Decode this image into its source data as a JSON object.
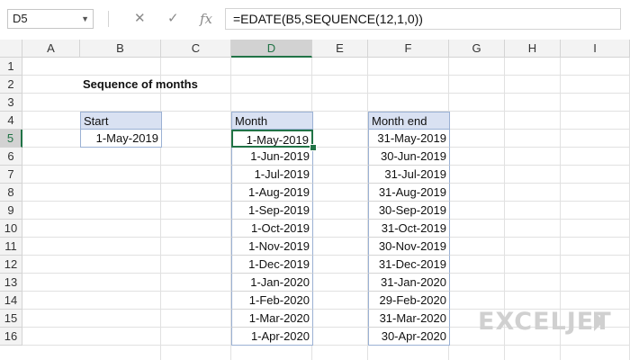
{
  "formula_bar": {
    "name_box": "D5",
    "cancel_icon": "✕",
    "enter_icon": "✓",
    "fx_icon": "fx",
    "formula": "=EDATE(B5,SEQUENCE(12,1,0))"
  },
  "columns": [
    "A",
    "B",
    "C",
    "D",
    "E",
    "F",
    "G",
    "H",
    "I"
  ],
  "rows": [
    "1",
    "2",
    "3",
    "4",
    "5",
    "6",
    "7",
    "8",
    "9",
    "10",
    "11",
    "12",
    "13",
    "14",
    "15",
    "16"
  ],
  "selected": {
    "column": "D",
    "row": "5"
  },
  "sheet": {
    "title": "Sequence of months",
    "start_header": "Start",
    "start_value": "1-May-2019",
    "month_header": "Month",
    "month_end_header": "Month end",
    "months": [
      "1-May-2019",
      "1-Jun-2019",
      "1-Jul-2019",
      "1-Aug-2019",
      "1-Sep-2019",
      "1-Oct-2019",
      "1-Nov-2019",
      "1-Dec-2019",
      "1-Jan-2020",
      "1-Feb-2020",
      "1-Mar-2020",
      "1-Apr-2020"
    ],
    "month_ends": [
      "31-May-2019",
      "30-Jun-2019",
      "31-Jul-2019",
      "31-Aug-2019",
      "30-Sep-2019",
      "31-Oct-2019",
      "30-Nov-2019",
      "31-Dec-2019",
      "31-Jan-2020",
      "29-Feb-2020",
      "31-Mar-2020",
      "30-Apr-2020"
    ]
  },
  "brand": {
    "logo": "EXCELJET",
    "logo_color": "#d0d0d0",
    "accent": "#217346"
  }
}
